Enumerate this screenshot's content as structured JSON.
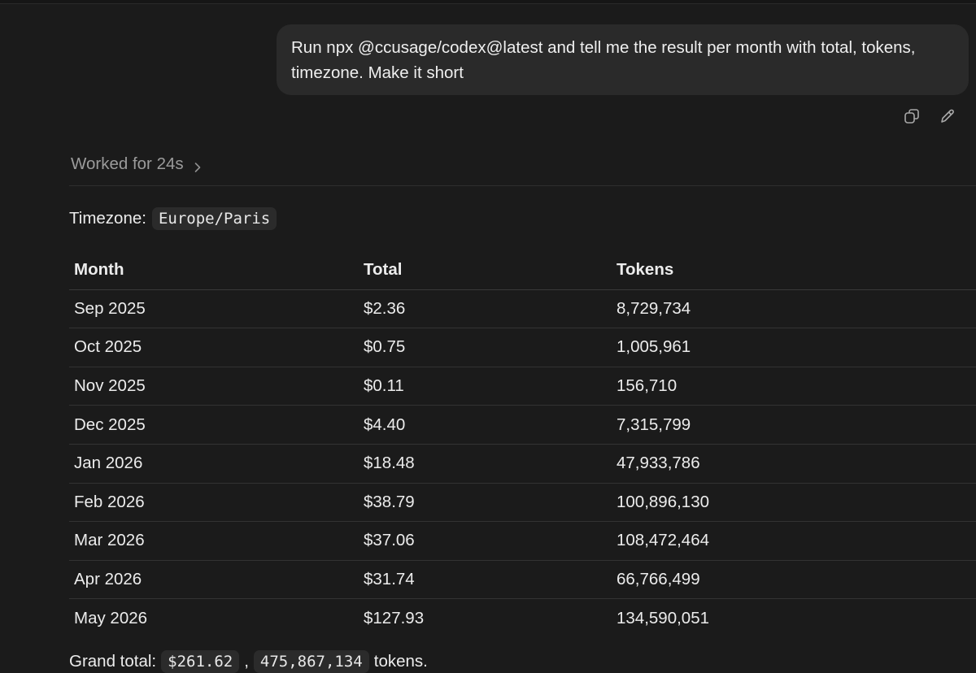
{
  "user_message": {
    "text": "Run npx @ccusage/codex@latest and tell me the result per month with total, tokens, timezone. Make it short",
    "actions": [
      "copy-icon",
      "edit-icon"
    ]
  },
  "assistant": {
    "worked_label": "Worked for 24s",
    "timezone_label": "Timezone:",
    "timezone_value": "Europe/Paris",
    "table": {
      "headers": [
        "Month",
        "Total",
        "Tokens"
      ],
      "rows": [
        [
          "Sep 2025",
          "$2.36",
          "8,729,734"
        ],
        [
          "Oct 2025",
          "$0.75",
          "1,005,961"
        ],
        [
          "Nov 2025",
          "$0.11",
          "156,710"
        ],
        [
          "Dec 2025",
          "$4.40",
          "7,315,799"
        ],
        [
          "Jan 2026",
          "$18.48",
          "47,933,786"
        ],
        [
          "Feb 2026",
          "$38.79",
          "100,896,130"
        ],
        [
          "Mar 2026",
          "$37.06",
          "108,472,464"
        ],
        [
          "Apr 2026",
          "$31.74",
          "66,766,499"
        ],
        [
          "May 2026",
          "$127.93",
          "134,590,051"
        ]
      ]
    },
    "grand_total": {
      "label": "Grand total:",
      "amount": "$261.62",
      "separator": ",",
      "tokens": "475,867,134",
      "suffix": "tokens."
    }
  }
}
